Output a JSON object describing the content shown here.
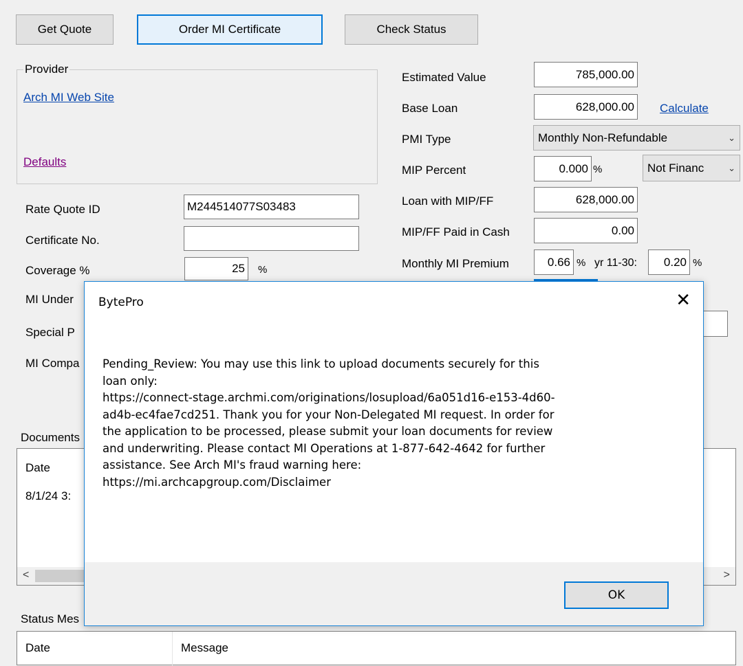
{
  "toolbar": {
    "get_quote": "Get Quote",
    "order_certificate": "Order MI Certificate",
    "check_status": "Check Status"
  },
  "provider": {
    "group_label": "Provider",
    "website_link": "Arch MI Web Site",
    "defaults_link": "Defaults"
  },
  "fields": {
    "rate_quote_id_label": "Rate Quote ID",
    "rate_quote_id_value": "M244514077S03483",
    "certificate_no_label": "Certificate No.",
    "certificate_no_value": "",
    "coverage_label": "Coverage %",
    "coverage_value": "25",
    "coverage_unit": "%",
    "mi_underwriter_label": "MI Under",
    "special_label": "Special P",
    "mi_company_label": "MI Compa"
  },
  "loan": {
    "estimated_value_label": "Estimated Value",
    "estimated_value": "785,000.00",
    "base_loan_label": "Base Loan",
    "base_loan": "628,000.00",
    "calculate_link": "Calculate",
    "pmi_type_label": "PMI Type",
    "pmi_type": "Monthly Non-Refundable",
    "mip_percent_label": "MIP Percent",
    "mip_percent": "0.000",
    "mip_unit": "%",
    "financing": "Not Financ",
    "loan_with_mip_label": "Loan with MIP/FF",
    "loan_with_mip": "628,000.00",
    "mip_paid_cash_label": "MIP/FF Paid in Cash",
    "mip_paid_cash": "0.00",
    "monthly_premium_label": "Monthly MI Premium",
    "monthly_premium": "0.66",
    "monthly_premium_unit": "%",
    "yr_label": "yr 11-30:",
    "yr_value": "0.20",
    "yr_unit": "%"
  },
  "documents": {
    "label": "Documents",
    "col_date": "Date",
    "row_date": "8/1/24 3:"
  },
  "status": {
    "label": "Status Mes",
    "col_date": "Date",
    "col_message": "Message"
  },
  "dialog": {
    "title": "BytePro",
    "close_glyph": "✕",
    "message": "Pending_Review: You may use this link to upload documents securely for this\nloan only:\nhttps://connect-stage.archmi.com/originations/losupload/6a051d16-e153-4d60-\nad4b-ec4fae7cd251. Thank you for your Non-Delegated MI request. In order for\nthe application to be processed, please submit your loan documents for review\nand underwriting. Please contact MI Operations at 1-877-642-4642 for further\nassistance. See Arch MI's fraud warning here:\nhttps://mi.archcapgroup.com/Disclaimer",
    "ok": "OK"
  },
  "scroll": {
    "left_glyph": "<",
    "right_glyph": ">"
  }
}
